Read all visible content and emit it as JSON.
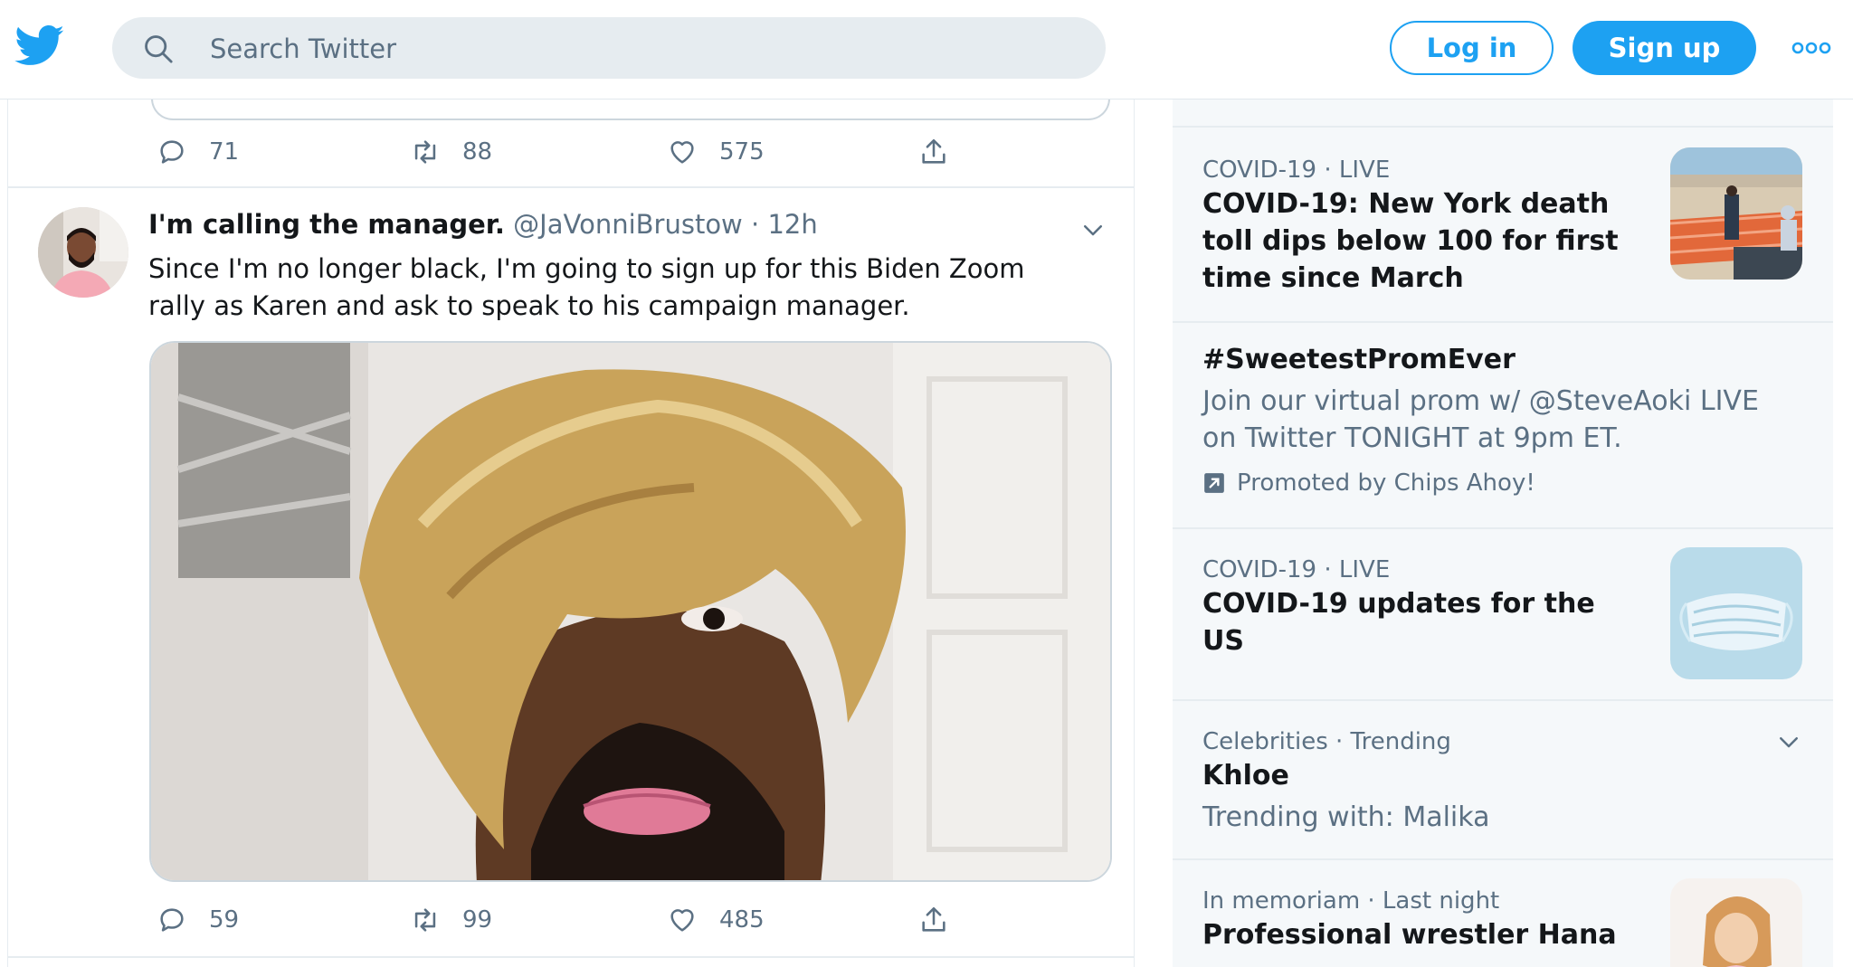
{
  "header": {
    "search_placeholder": "Search Twitter",
    "login_label": "Log in",
    "signup_label": "Sign up"
  },
  "feed": {
    "prev_tweet_actions": {
      "replies": "71",
      "retweets": "88",
      "likes": "575"
    },
    "tweet": {
      "name": "I'm calling the manager.",
      "handle": "@JaVonniBrustow",
      "time": "12h",
      "text": "Since I'm no longer black, I'm going to sign up for this Biden Zoom rally as Karen and ask to speak to his campaign manager.",
      "actions": {
        "replies": "59",
        "retweets": "99",
        "likes": "485"
      }
    }
  },
  "sidebar": {
    "trends": [
      {
        "meta": "COVID-19 · LIVE",
        "title": "COVID-19: New York death toll dips below 100 for first time since March"
      },
      {
        "title": "#SweetestPromEver",
        "desc": "Join our virtual prom w/ @SteveAoki LIVE on Twitter TONIGHT at 9pm ET.",
        "promoted": "Promoted by Chips Ahoy!"
      },
      {
        "meta": "COVID-19 · LIVE",
        "title": "COVID-19 updates for the US"
      },
      {
        "meta": "Celebrities · Trending",
        "title": "Khloe",
        "desc": "Trending with: Malika"
      },
      {
        "meta": "In memoriam · Last night",
        "title": "Professional wrestler Hana"
      }
    ]
  },
  "colors": {
    "accent": "#1da1f2",
    "muted": "#5b7083",
    "text": "#14171a",
    "sidebar_bg": "#f5f8fa"
  }
}
